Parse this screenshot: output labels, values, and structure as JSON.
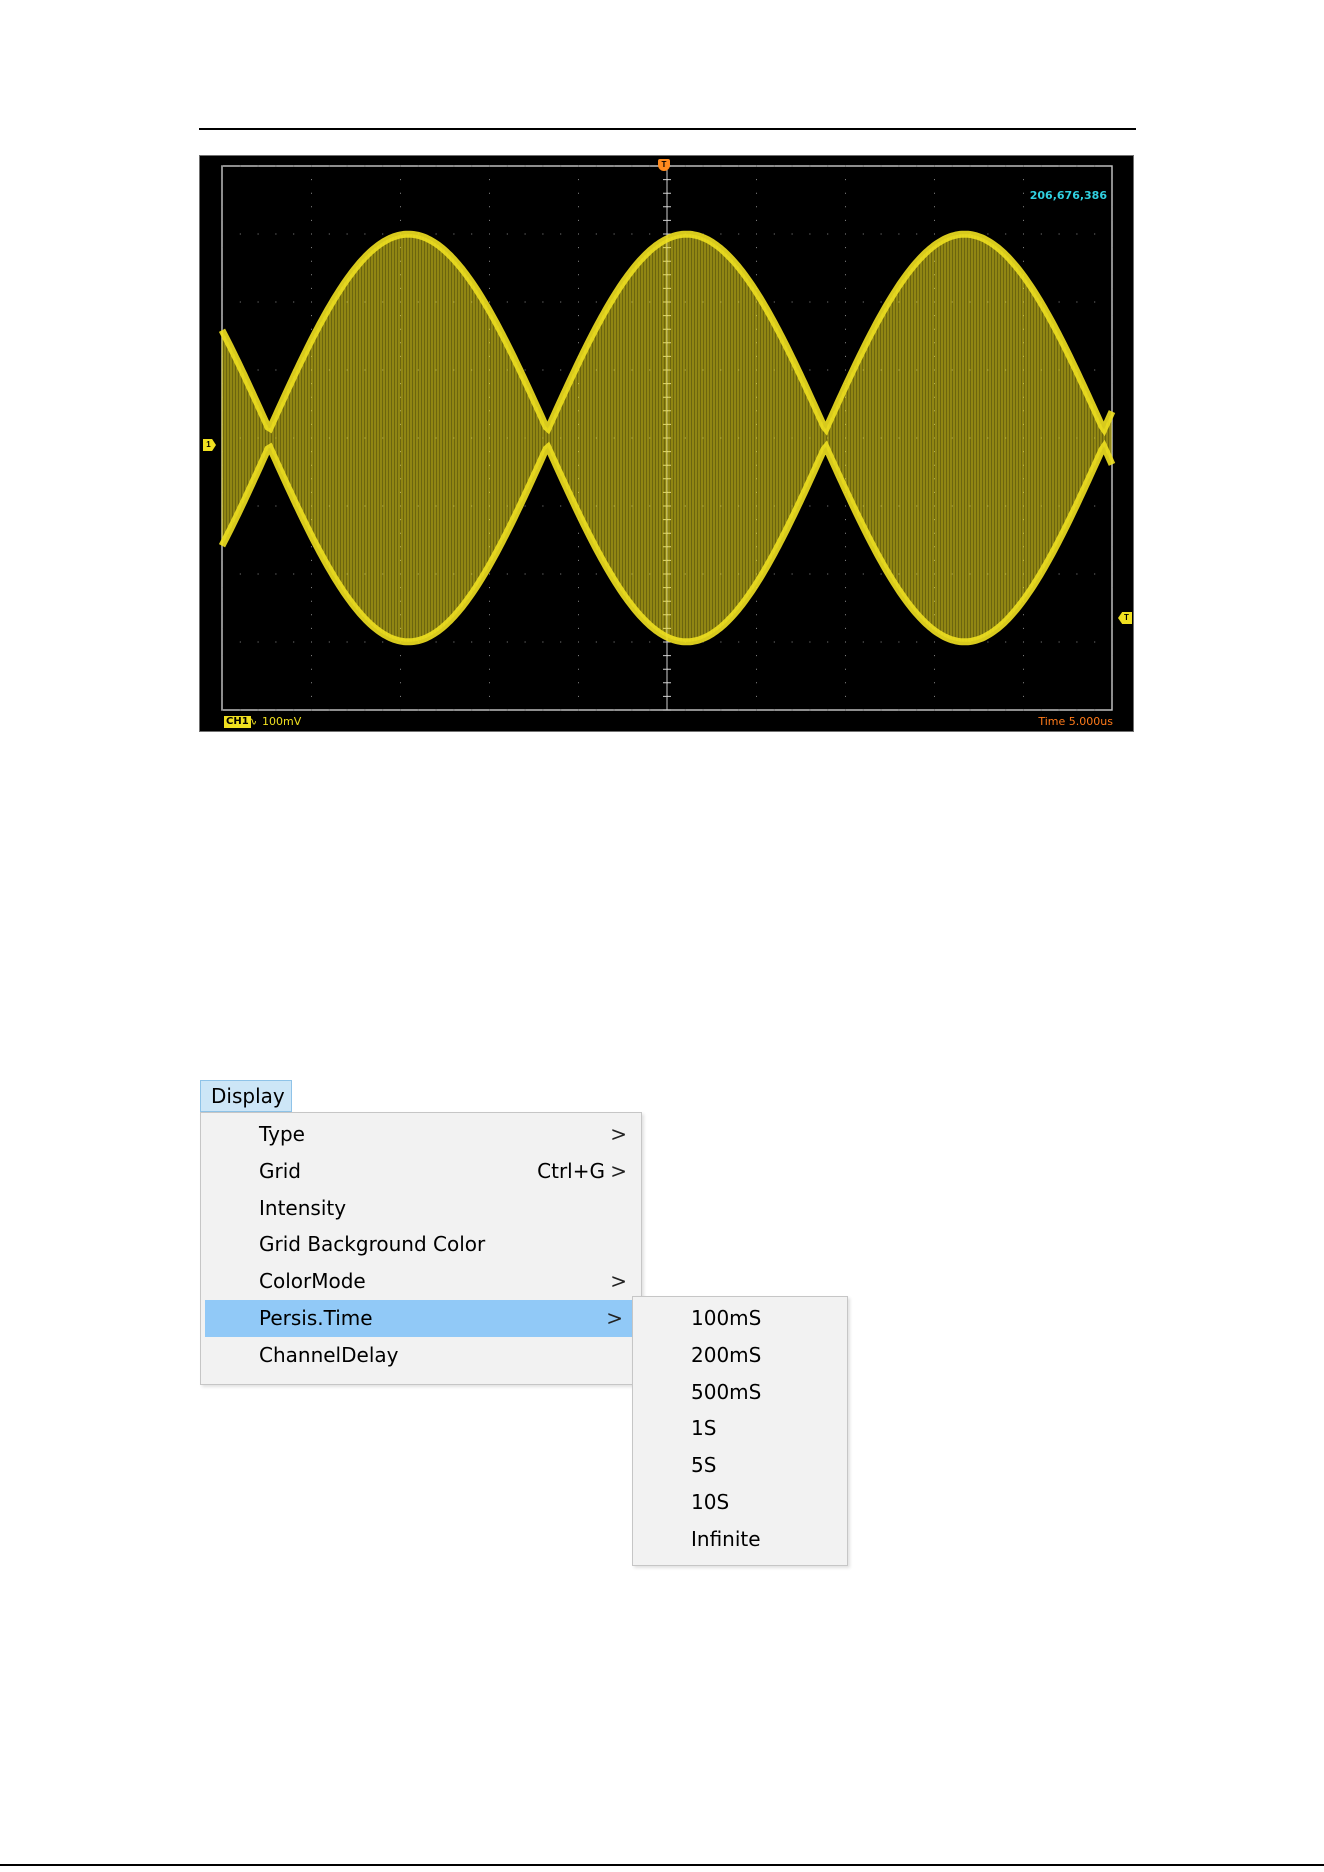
{
  "scope": {
    "sample_counter": "206,676,386",
    "channel_label": "CH1",
    "coupling_symbol": "∿",
    "volts_per_div": "100mV",
    "timebase": "Time 5.000us",
    "trigger_position_marker": "T",
    "channel_marker": "1",
    "trigger_level_marker": "T",
    "colors": {
      "trace": "#f0e020",
      "background": "#000000",
      "counter": "#30d0e0",
      "timebase": "#ff7a1a"
    }
  },
  "menu": {
    "title": "Display",
    "items": [
      {
        "label": "Type",
        "shortcut": "",
        "submenu": ">"
      },
      {
        "label": "Grid",
        "shortcut": "Ctrl+G",
        "submenu": ">"
      },
      {
        "label": "Intensity",
        "shortcut": "",
        "submenu": ""
      },
      {
        "label": "Grid Background Color",
        "shortcut": "",
        "submenu": ""
      },
      {
        "label": "ColorMode",
        "shortcut": "",
        "submenu": ">"
      },
      {
        "label": "Persis.Time",
        "shortcut": "",
        "submenu": ">",
        "highlighted": true
      },
      {
        "label": "ChannelDelay",
        "shortcut": "",
        "submenu": ""
      }
    ],
    "persis_time_options": [
      "100mS",
      "200mS",
      "500mS",
      "1S",
      "5S",
      "10S",
      "Infinite"
    ]
  }
}
